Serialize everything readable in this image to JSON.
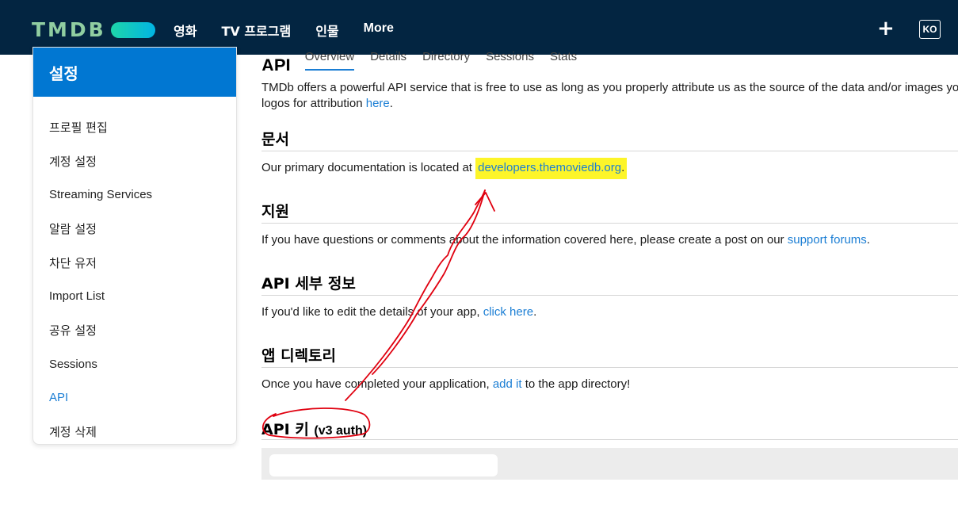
{
  "header": {
    "logo_text": "TMDB",
    "nav": [
      "영화",
      "TV 프로그램",
      "인물",
      "More"
    ],
    "plus_icon": "+",
    "language": "KO"
  },
  "sidebar": {
    "title": "설정",
    "items": [
      "프로필 편집",
      "계정 설정",
      "Streaming Services",
      "알람 설정",
      "차단 유저",
      "Import List",
      "공유 설정",
      "Sessions",
      "API",
      "계정 삭제"
    ],
    "active_index": 8
  },
  "main": {
    "title": "API",
    "tabs": [
      "Overview",
      "Details",
      "Directory",
      "Sessions",
      "Stats"
    ],
    "intro": {
      "text_1": "TMDb offers a powerful API service that is free to use as long as you properly attribute us as the source of the data and/or images you",
      "text_2": "logos for attribution ",
      "link": "here",
      "text_3": "."
    },
    "docs": {
      "title": "문서",
      "text": "Our primary documentation is located at ",
      "link": "developers.themoviedb.org",
      "end": "."
    },
    "support": {
      "title": "지원",
      "text": "If you have questions or comments about the information covered here, please create a post on our ",
      "link": "support forums",
      "end": "."
    },
    "details": {
      "title": "API 세부 정보",
      "text": "If you'd like to edit the details of your app, ",
      "link": "click here",
      "end": "."
    },
    "directory": {
      "title": "앱 디렉토리",
      "text": "Once you have completed your application, ",
      "link": "add it",
      "end": " to the app directory!"
    },
    "api_key": {
      "title": "API 키",
      "subtitle": "(v3 auth)"
    }
  },
  "colors": {
    "header_bg": "#032541",
    "accent": "#0177d2",
    "link": "#1b7ed4",
    "highlight": "#fdf529",
    "annotation": "#e0000f"
  }
}
